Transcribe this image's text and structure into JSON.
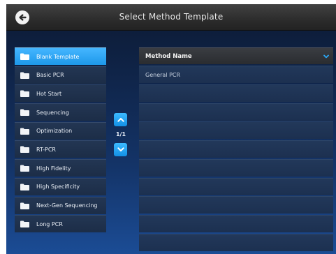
{
  "header": {
    "title": "Select Method Template",
    "back_icon": "arrow-left-circle-icon"
  },
  "categories": [
    {
      "label": "Blank Template",
      "icon": "folder-icon",
      "selected": true
    },
    {
      "label": "Basic PCR",
      "icon": "folder-icon"
    },
    {
      "label": "Hot Start",
      "icon": "folder-icon"
    },
    {
      "label": "Sequencing",
      "icon": "folder-icon"
    },
    {
      "label": "Optimization",
      "icon": "folder-icon"
    },
    {
      "label": "RT-PCR",
      "icon": "folder-icon"
    },
    {
      "label": "High Fidelity",
      "icon": "folder-icon"
    },
    {
      "label": "High Specificity",
      "icon": "folder-icon"
    },
    {
      "label": "Next-Gen Sequencing",
      "icon": "folder-icon"
    },
    {
      "label": "Long PCR",
      "icon": "folder-icon"
    }
  ],
  "pager": {
    "label": "1/1",
    "up_icon": "chevron-up-icon",
    "down_icon": "chevron-down-icon"
  },
  "table": {
    "header_label": "Method Name",
    "sort_icon": "chevron-down-icon",
    "rows": [
      "General PCR",
      "",
      "",
      "",
      "",
      "",
      "",
      "",
      "",
      ""
    ]
  },
  "colors": {
    "accent": "#2aa8f7",
    "titlebar": "#333333",
    "background": "#143468"
  }
}
